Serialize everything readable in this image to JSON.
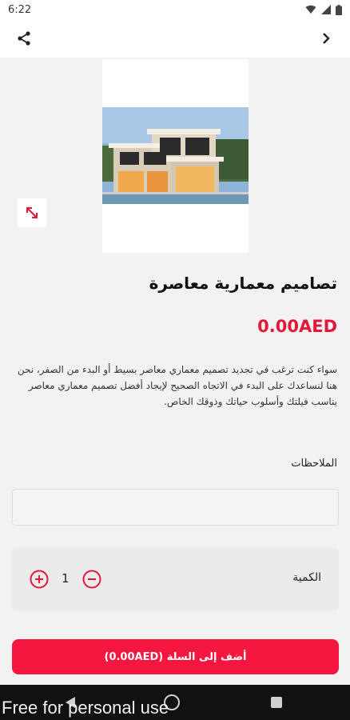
{
  "status_bar": {
    "time": "6:22"
  },
  "icons": {
    "share": "share-icon",
    "forward": "chevron-right-icon",
    "expand": "expand-diagonal-icon",
    "plus": "plus-circle-icon",
    "minus": "minus-circle-icon"
  },
  "product": {
    "title": "تصاميم معمارية معاصرة",
    "price": "0.00AED",
    "description": "سواء كنت ترغب في تجديد تصميم معماري معاصر بسيط أو البدء من الصفر، نحن هنا لنساعدك على البدء في الاتجاه الصحيح لإيجاد أفضل تصميم معماري معاصر يناسب فيلتك وأسلوب حياتك وذوقك الخاص."
  },
  "notes": {
    "label": "الملاحظات",
    "value": "",
    "placeholder": ""
  },
  "quantity": {
    "label": "الكمية",
    "value": "1"
  },
  "cart": {
    "button_label": "أضف إلى السلة (0.00AED)"
  },
  "watermark": "Free for personal use",
  "colors": {
    "accent": "#f5173f",
    "price": "#e3173a"
  }
}
